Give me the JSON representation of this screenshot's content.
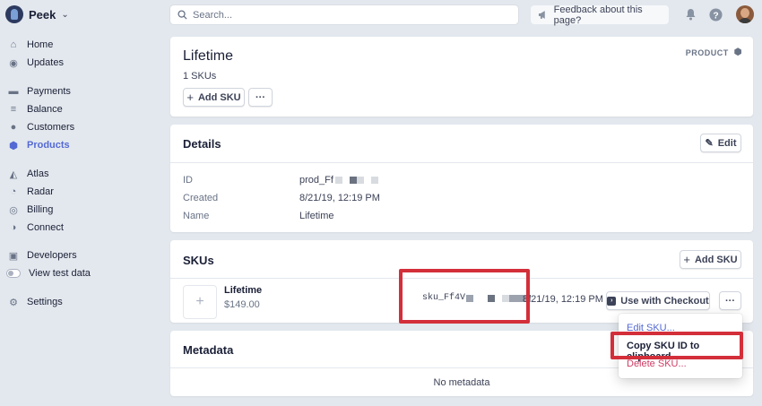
{
  "sidebar": {
    "account_name": "Peek",
    "items": [
      {
        "label": "Home",
        "icon": "home-icon",
        "glyph": "⌂"
      },
      {
        "label": "Updates",
        "icon": "updates-icon",
        "glyph": "◉"
      },
      {
        "label": "Payments",
        "icon": "payments-icon",
        "glyph": "▬"
      },
      {
        "label": "Balance",
        "icon": "balance-icon",
        "glyph": "≡"
      },
      {
        "label": "Customers",
        "icon": "customers-icon",
        "glyph": "●"
      },
      {
        "label": "Products",
        "icon": "products-icon",
        "glyph": "⬢",
        "active": true
      },
      {
        "label": "Atlas",
        "icon": "atlas-icon",
        "glyph": "◭"
      },
      {
        "label": "Radar",
        "icon": "radar-icon",
        "glyph": "◔"
      },
      {
        "label": "Billing",
        "icon": "billing-icon",
        "glyph": "◎"
      },
      {
        "label": "Connect",
        "icon": "connect-icon",
        "glyph": "◑"
      },
      {
        "label": "Developers",
        "icon": "developers-icon",
        "glyph": "▣"
      },
      {
        "label": "View test data",
        "icon": "toggle-icon"
      },
      {
        "label": "Settings",
        "icon": "settings-icon",
        "glyph": "⚙"
      }
    ]
  },
  "topbar": {
    "search_placeholder": "Search...",
    "feedback_label": "Feedback about this page?"
  },
  "product": {
    "title": "Lifetime",
    "sku_count": "1 SKUs",
    "add_sku_label": "Add SKU",
    "more_label": "···",
    "type_badge": "PRODUCT"
  },
  "details": {
    "heading": "Details",
    "edit_label": "Edit",
    "rows": [
      {
        "label": "ID",
        "value": "prod_Ff"
      },
      {
        "label": "Created",
        "value": "8/21/19, 12:19 PM"
      },
      {
        "label": "Name",
        "value": "Lifetime"
      }
    ]
  },
  "skus": {
    "heading": "SKUs",
    "add_sku_label": "Add SKU",
    "item": {
      "name": "Lifetime",
      "price": "$149.00",
      "id": "sku_Ff4V",
      "created": "8/21/19, 12:19 PM",
      "checkout_label": "Use with Checkout",
      "more_label": "···"
    }
  },
  "menu": {
    "items": [
      "Edit SKU...",
      "Copy SKU ID to clipboard",
      "Delete SKU..."
    ]
  },
  "metadata": {
    "heading": "Metadata",
    "empty_text": "No metadata"
  },
  "colors": {
    "accent": "#5469d4",
    "background": "#e3e8ee",
    "highlight": "#d32f3a",
    "danger": "#cd3d64"
  }
}
